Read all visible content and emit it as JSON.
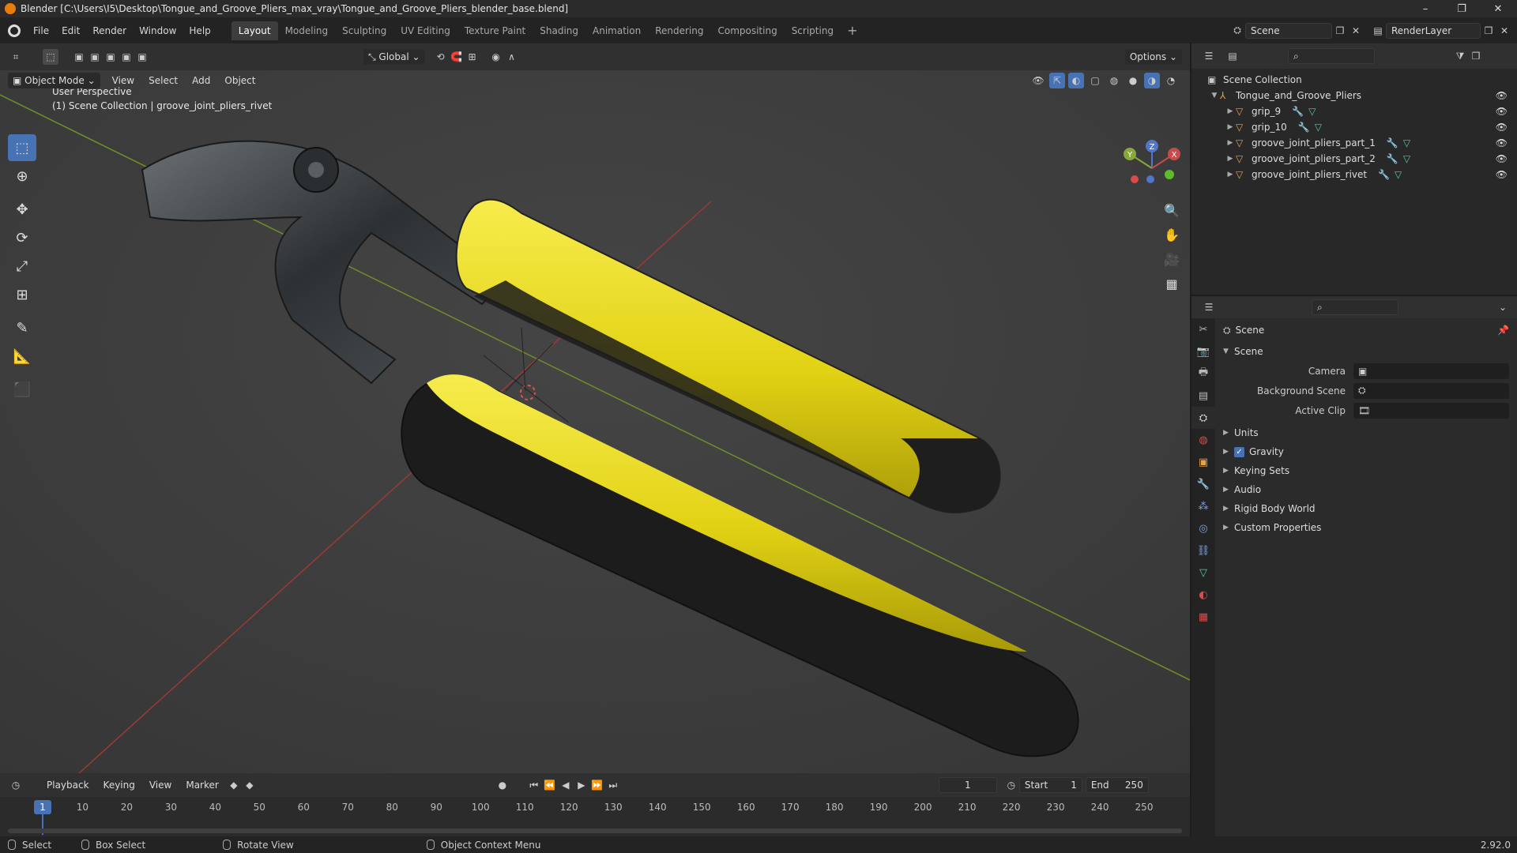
{
  "window": {
    "title": "Blender [C:\\Users\\I5\\Desktop\\Tongue_and_Groove_Pliers_max_vray\\Tongue_and_Groove_Pliers_blender_base.blend]",
    "minimize": "–",
    "maximize": "❐",
    "close": "✕"
  },
  "menubar": {
    "items": [
      "File",
      "Edit",
      "Render",
      "Window",
      "Help"
    ],
    "workspaces": [
      "Layout",
      "Modeling",
      "Sculpting",
      "UV Editing",
      "Texture Paint",
      "Shading",
      "Animation",
      "Rendering",
      "Compositing",
      "Scripting"
    ],
    "active_workspace": "Layout",
    "add_workspace": "+",
    "scene_name": "Scene",
    "view_layer": "RenderLayer"
  },
  "viewport": {
    "transform_orientation": "Global",
    "options_label": "Options",
    "mode": "Object Mode",
    "menus": [
      "View",
      "Select",
      "Add",
      "Object"
    ],
    "overlay_line1": "User Perspective",
    "overlay_line2": "(1) Scene Collection | groove_joint_pliers_rivet",
    "gizmo_axes": {
      "z": "Z",
      "y": "Y",
      "x": "X"
    }
  },
  "outliner": {
    "root": "Scene Collection",
    "collection": "Tongue_and_Groove_Pliers",
    "objects": [
      "grip_9",
      "grip_10",
      "groove_joint_pliers_part_1",
      "groove_joint_pliers_part_2",
      "groove_joint_pliers_rivet"
    ]
  },
  "properties": {
    "context": "Scene",
    "panel": "Scene",
    "fields": [
      {
        "label": "Camera"
      },
      {
        "label": "Background Scene"
      },
      {
        "label": "Active Clip"
      }
    ],
    "subpanels": [
      "Units",
      "Gravity",
      "Keying Sets",
      "Audio",
      "Rigid Body World",
      "Custom Properties"
    ]
  },
  "timeline": {
    "menus": [
      "Playback",
      "Keying",
      "View",
      "Marker"
    ],
    "current_frame": "1",
    "start_label": "Start",
    "start_value": "1",
    "end_label": "End",
    "end_value": "250",
    "cursor_frame": "1",
    "ticks": [
      "10",
      "20",
      "30",
      "40",
      "50",
      "60",
      "70",
      "80",
      "90",
      "100",
      "110",
      "120",
      "130",
      "140",
      "150",
      "160",
      "170",
      "180",
      "190",
      "200",
      "210",
      "220",
      "230",
      "240",
      "250"
    ]
  },
  "statusbar": {
    "select": "Select",
    "box_select": "Box Select",
    "rotate_view": "Rotate View",
    "context_menu": "Object Context Menu",
    "version": "2.92.0"
  },
  "colors": {
    "accent": "#4772b3",
    "handle_yellow": "#f1e31a",
    "handle_black": "#1a1a1a"
  }
}
